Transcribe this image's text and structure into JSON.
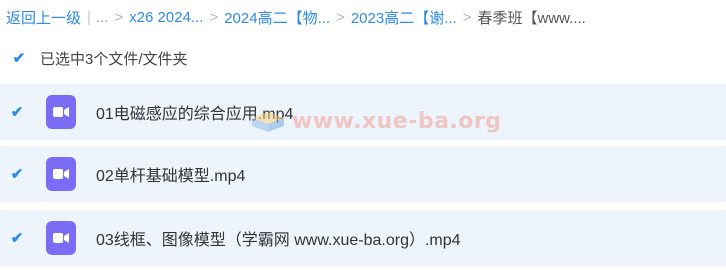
{
  "breadcrumb": {
    "back_label": "返回上一级",
    "ellipsis": "...",
    "items": [
      "x26 2024...",
      "2024高二【物...",
      "2023高二【谢...",
      "春季班【www...."
    ],
    "separator": ">"
  },
  "selection": {
    "checked": true,
    "label": "已选中3个文件/文件夹"
  },
  "files": [
    {
      "name": "01电磁感应的综合应用.mp4",
      "checked": true,
      "icon": "video-file-icon"
    },
    {
      "name": "02单杆基础模型.mp4",
      "checked": true,
      "icon": "video-file-icon"
    },
    {
      "name": "03线框、图像模型（学霸网 www.xue-ba.org）.mp4",
      "checked": true,
      "icon": "video-file-icon"
    }
  ],
  "watermark": {
    "text": "www.xue-ba.org"
  },
  "colors": {
    "accent": "#2f8be6",
    "row_selected_bg": "#eef4fc",
    "video_icon": "#7b6cf6"
  }
}
